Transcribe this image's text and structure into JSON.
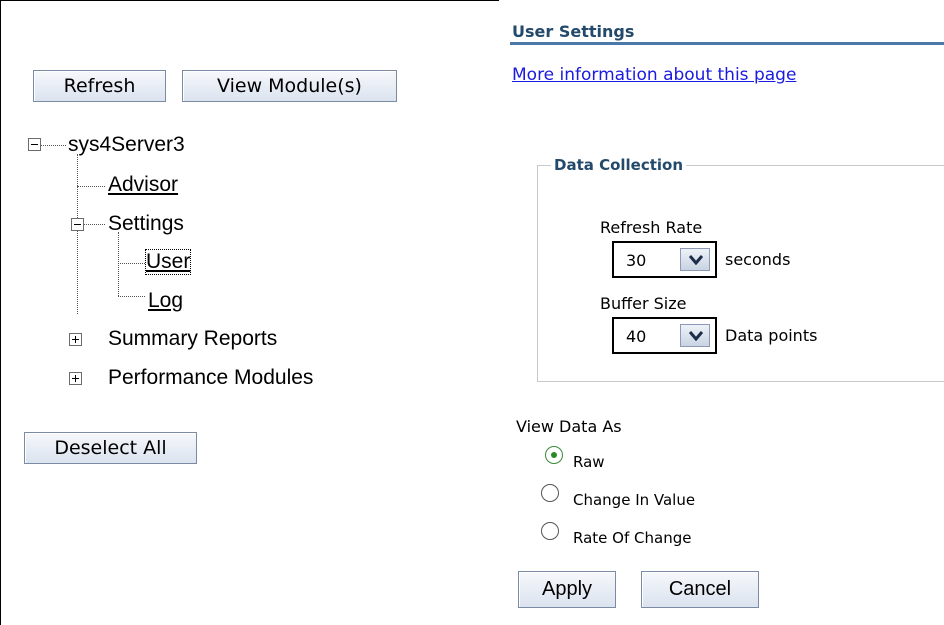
{
  "left": {
    "refresh_label": "Refresh",
    "view_modules_label": "View Module(s)",
    "deselect_all_label": "Deselect All",
    "tree": {
      "root": "sys4Server3",
      "advisor": "Advisor",
      "settings": "Settings",
      "user": "User",
      "log": "Log",
      "summary_reports": "Summary Reports",
      "performance_modules": "Performance Modules"
    }
  },
  "right": {
    "title": "User Settings",
    "more_info_link": "More information about this page",
    "data_collection": {
      "legend": "Data Collection",
      "refresh_rate_label": "Refresh Rate",
      "refresh_rate_value": "30",
      "refresh_rate_unit": "seconds",
      "buffer_size_label": "Buffer Size",
      "buffer_size_value": "40",
      "buffer_size_unit": "Data points"
    },
    "view_data_as": {
      "label": "View Data As",
      "options": [
        "Raw",
        "Change In Value",
        "Rate Of Change"
      ],
      "selected": "Raw"
    },
    "apply_label": "Apply",
    "cancel_label": "Cancel"
  },
  "colors": {
    "heading": "#23496b",
    "rule": "#4a78a8",
    "link": "#1a1ae0",
    "radio_selected": "#2a8a2a"
  }
}
